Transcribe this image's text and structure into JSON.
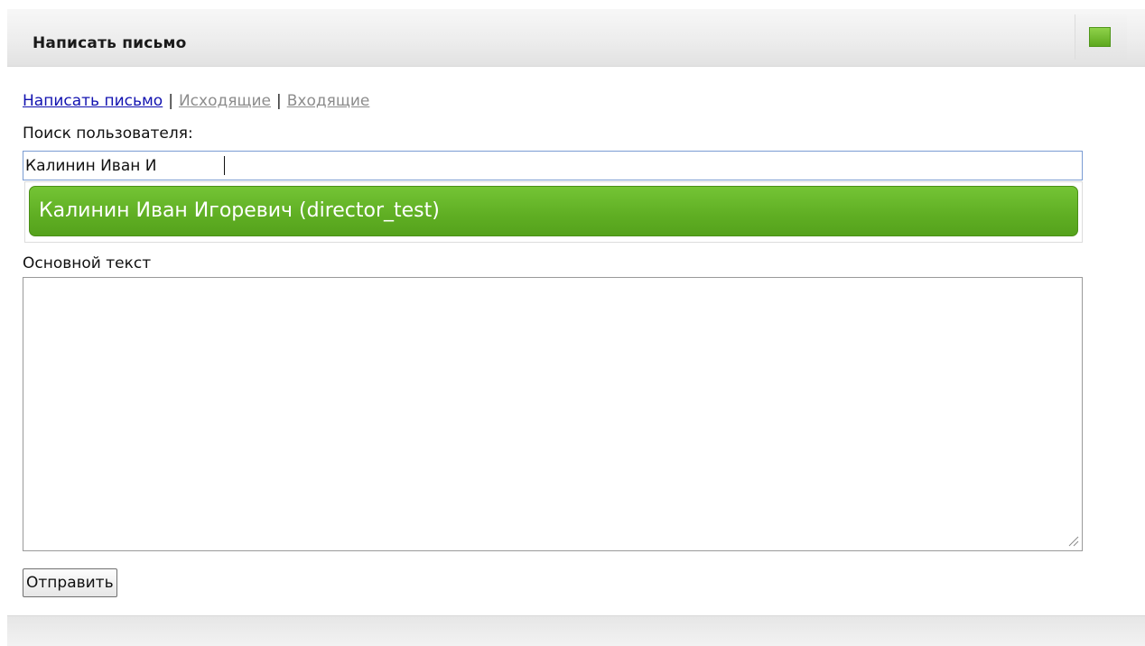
{
  "header": {
    "title": "Написать письмо",
    "button_icon": "green-square-icon",
    "accent_color": "#6ab82b"
  },
  "nav": {
    "items": [
      {
        "label": "Написать письмо",
        "active": true
      },
      {
        "label": "Исходящие",
        "active": false
      },
      {
        "label": "Входящие",
        "active": false
      }
    ],
    "separator": "|"
  },
  "search": {
    "label": "Поиск пользователя:",
    "value": "Калинин Иван И",
    "suggestion": "Калинин Иван Игоревич (director_test)"
  },
  "message": {
    "label": "Основной текст",
    "value": ""
  },
  "send_label": "Отправить"
}
